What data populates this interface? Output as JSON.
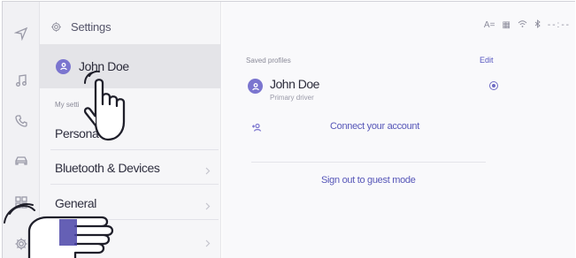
{
  "rail": {
    "icons": [
      "navigation-icon",
      "music-icon",
      "phone-icon",
      "car-icon",
      "apps-icon",
      "gear-icon"
    ]
  },
  "settings_panel": {
    "title": "Settings",
    "profile_name": "John Doe",
    "section_label": "My setti",
    "items": [
      {
        "label": "Persona"
      },
      {
        "label": "Bluetooth & Devices"
      },
      {
        "label": "General"
      }
    ]
  },
  "status_bar": {
    "text_size_label": "A=",
    "time_text": "--:--"
  },
  "main": {
    "saved_profiles_label": "Saved profiles",
    "edit_label": "Edit",
    "profile": {
      "name": "John Doe",
      "role": "Primary driver"
    },
    "connect_account_label": "Connect your account",
    "sign_out_label": "Sign out to guest mode"
  },
  "colors": {
    "accent": "#7b75cf",
    "link": "#5656b8",
    "panel_bg": "#f6f6f8",
    "selected_bg": "#e4e4e8"
  }
}
